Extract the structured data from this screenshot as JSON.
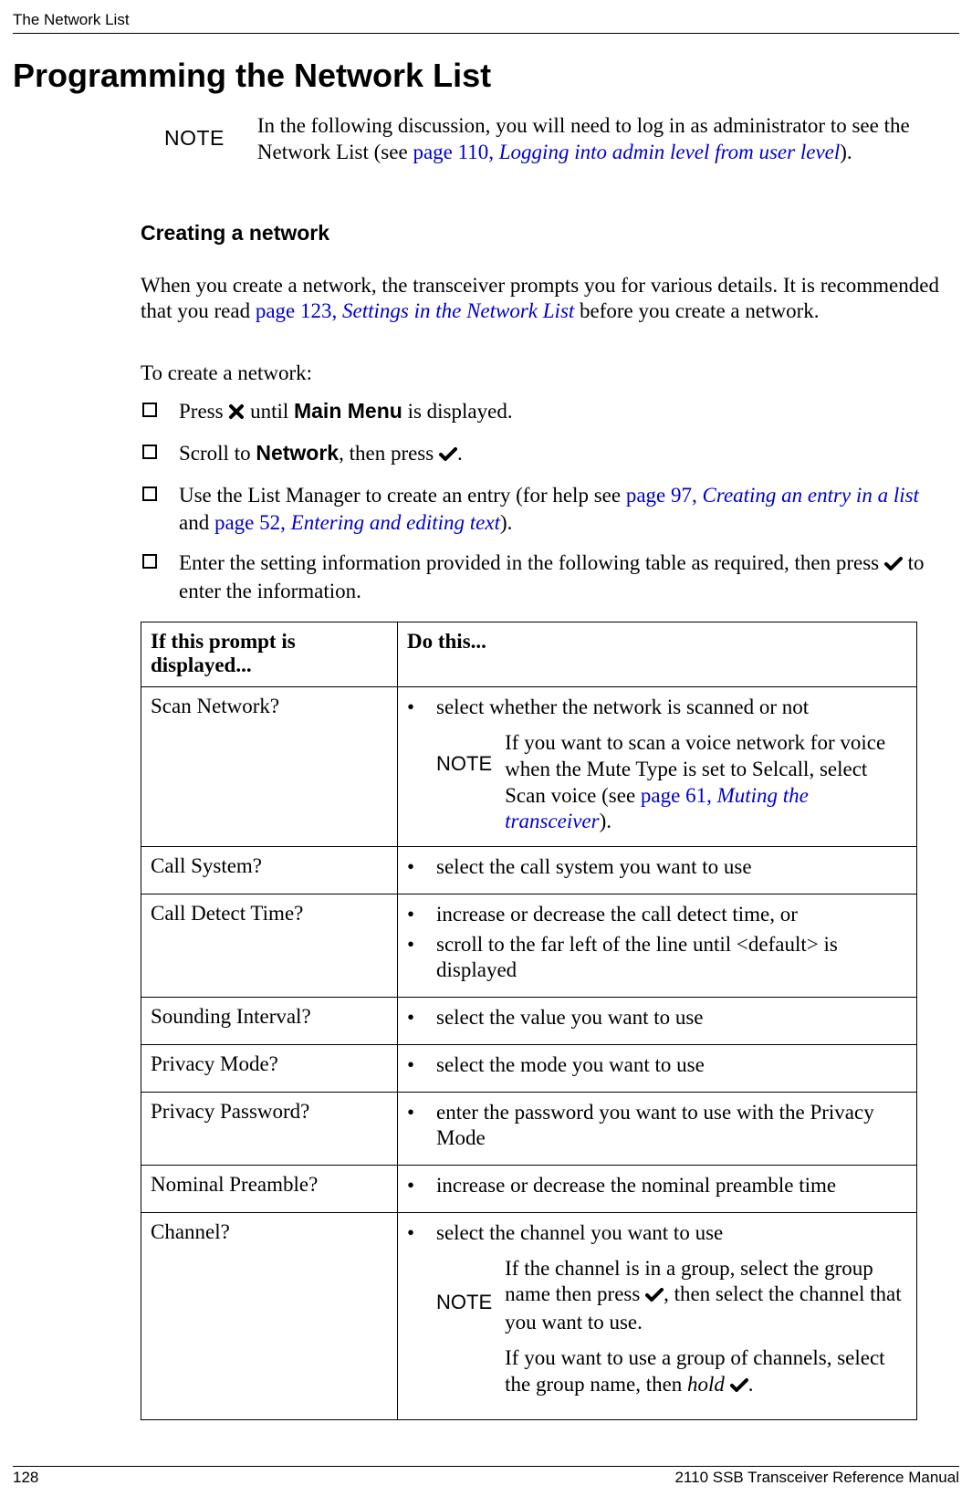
{
  "running_head": "The Network List",
  "h1": "Programming the Network List",
  "top_note": {
    "label": "NOTE",
    "body_pre": "In the following discussion, you will need to log in as administrator to see the Network List (see ",
    "link_page": "page 110, ",
    "link_text": "Logging into admin level from user level",
    "body_post": ")."
  },
  "h2": "Creating a network",
  "para1": {
    "pre": "When you create a network, the transceiver prompts you for various details. It is recommended that you read ",
    "link_page": "page 123, ",
    "link_text": "Settings in the Network List",
    "post": " before you create a network."
  },
  "intro": "To create a network:",
  "steps": {
    "s1_pre": "Press ",
    "s1_mid": " until ",
    "s1_bold": "Main Menu",
    "s1_post": " is displayed.",
    "s2_pre": "Scroll to ",
    "s2_bold": "Network",
    "s2_mid": ", then press ",
    "s2_post": ".",
    "s3_pre": "Use the List Manager to create an entry (for help see ",
    "s3_link1_page": "page 97, ",
    "s3_link1_text": "Creating an entry in a list",
    "s3_and": " and ",
    "s3_link2_page": "page 52, ",
    "s3_link2_text": "Entering and editing text",
    "s3_post": ").",
    "s4_pre": "Enter the setting information provided in the following table as required, then press ",
    "s4_post": " to enter the information."
  },
  "table": {
    "headers": [
      "If this prompt is displayed...",
      "Do this..."
    ],
    "rows": [
      {
        "prompt": "Scan Network?",
        "bullets": [
          "select whether the network is scanned or not"
        ],
        "note": {
          "label": "NOTE",
          "pre": "If you want to scan a voice network for voice when the Mute Type is set to Selcall, select Scan voice (see ",
          "link_page": "page 61, ",
          "link_text": "Muting the transceiver",
          "post": ")."
        }
      },
      {
        "prompt": "Call System?",
        "bullets": [
          "select the call system you want to use"
        ]
      },
      {
        "prompt": "Call Detect Time?",
        "bullets": [
          "increase or decrease the call detect time, or",
          "scroll to the far left of the line until <default> is displayed"
        ]
      },
      {
        "prompt": "Sounding Interval?",
        "bullets": [
          "select the value you want to use"
        ]
      },
      {
        "prompt": "Privacy Mode?",
        "bullets": [
          "select the mode you want to use"
        ]
      },
      {
        "prompt": "Privacy Password?",
        "bullets": [
          "enter the password you want to use with the Privacy Mode"
        ]
      },
      {
        "prompt": "Nominal Preamble?",
        "bullets": [
          "increase or decrease the nominal preamble time"
        ]
      },
      {
        "prompt": "Channel?",
        "bullets": [
          "select the channel you want to use"
        ],
        "note": {
          "label": "NOTE",
          "p1_pre": "If the channel is in a group, select the group name then press ",
          "p1_post": ", then select the channel that you want to use.",
          "p2_pre": "If you want to use a group of channels, select the group name, then ",
          "p2_ital": "hold",
          "p2_post": " "
        }
      }
    ]
  },
  "page_num": "128",
  "doc_title": "2110 SSB Transceiver Reference Manual"
}
